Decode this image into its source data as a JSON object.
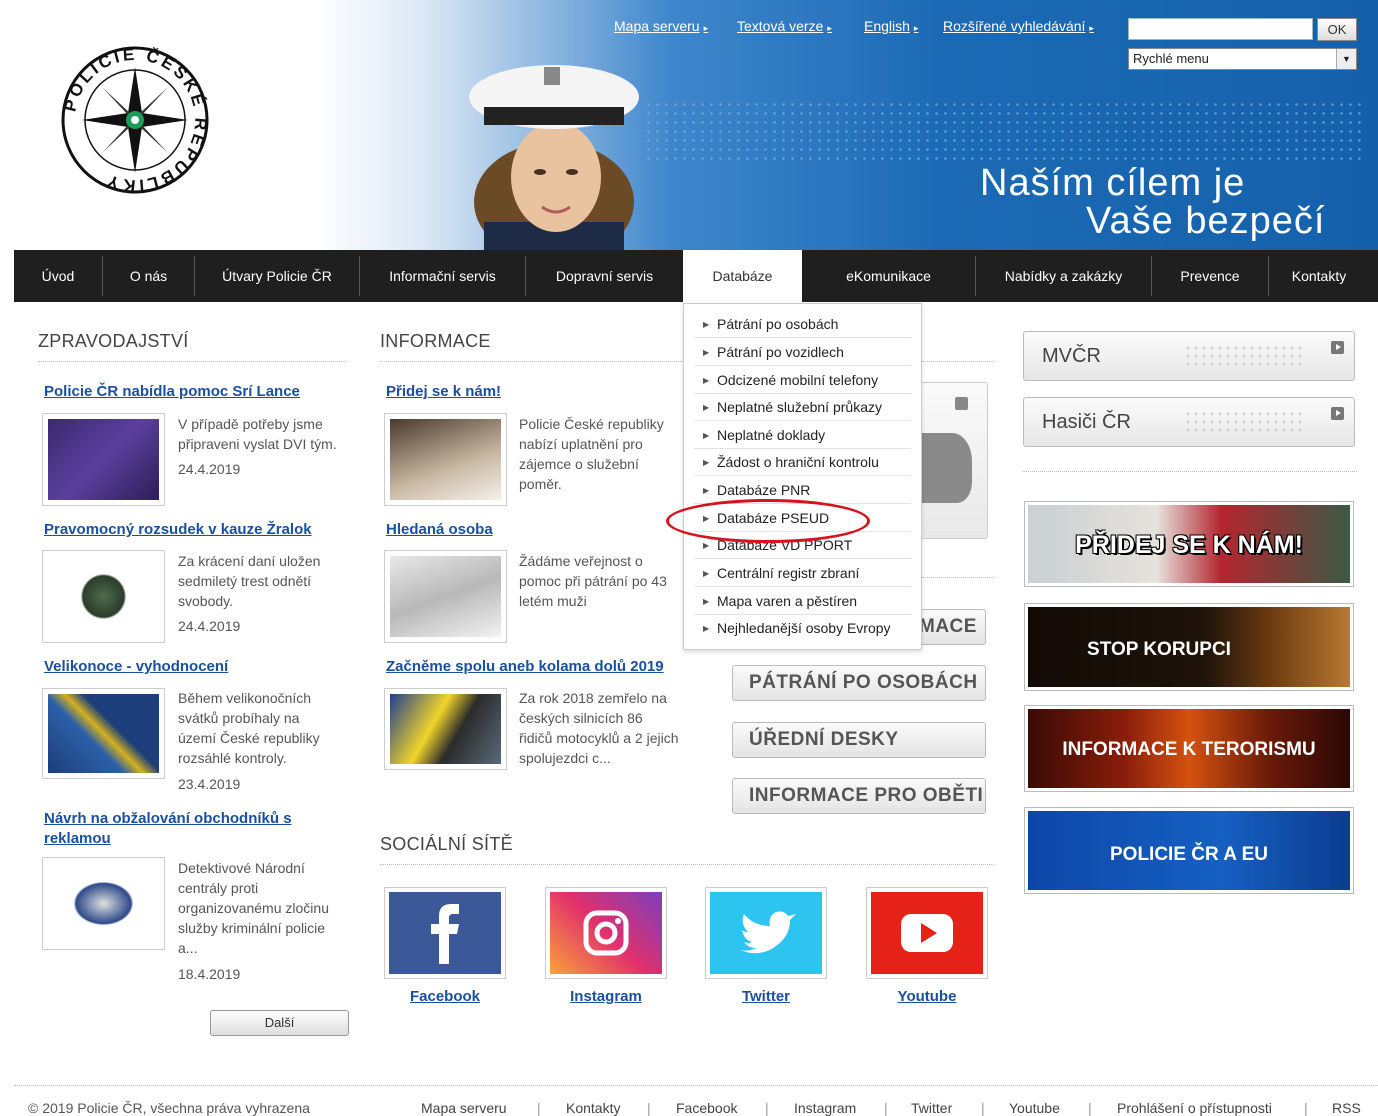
{
  "header": {
    "top_links": [
      "Mapa serveru",
      "Textová verze",
      "English",
      "Rozšířené vyhledávání"
    ],
    "search_placeholder": "",
    "search_button": "OK",
    "quick_menu": "Rychlé menu",
    "slogan_line1": "Naším cílem je",
    "slogan_line2": "Vaše bezpečí",
    "logo_text": "POLICIE ČESKÉ REPUBLIKY"
  },
  "nav": [
    "Úvod",
    "O nás",
    "Útvary Policie ČR",
    "Informační servis",
    "Dopravní servis",
    "Databáze",
    "eKomunikace",
    "Nabídky a zakázky",
    "Prevence",
    "Kontakty"
  ],
  "dropdown": [
    "Pátrání po osobách",
    "Pátrání po vozidlech",
    "Odcizené mobilní telefony",
    "Neplatné služební průkazy",
    "Neplatné doklady",
    "Žádost o hraniční kontrolu",
    "Databáze PNR",
    "Databáze PSEUD",
    "Databáze VD PPORT",
    "Centrální registr zbraní",
    "Mapa varen a pěstíren",
    "Nejhledanější osoby Evropy"
  ],
  "news": {
    "title": "ZPRAVODAJSTVÍ",
    "items": [
      {
        "title": "Policie ČR nabídla pomoc Srí Lance",
        "text": [
          "V případě potřeby jsme",
          "připraveni vyslat DVI tým."
        ],
        "date": "24.4.2019"
      },
      {
        "title": "Pravomocný rozsudek v kauze Žralok",
        "text": [
          "Za krácení daní uložen",
          "sedmiletý trest odnětí",
          "svobody."
        ],
        "date": "24.4.2019"
      },
      {
        "title": "Velikonoce - vyhodnocení",
        "text": [
          "Během velikonočních",
          "svátků probíhaly na",
          "území České republiky",
          "rozsáhlé kontroly."
        ],
        "date": "23.4.2019"
      },
      {
        "title_line1": "Návrh na obžalování obchodníků s",
        "title_line2": "reklamou",
        "text": [
          "Detektivové Národní",
          "centrály proti",
          "organizovanému zločinu",
          "služby kriminální policie",
          "a..."
        ],
        "date": "18.4.2019"
      }
    ],
    "more": "Další"
  },
  "info": {
    "title": "INFORMACE",
    "items": [
      {
        "title": "Přidej se k nám!",
        "text": [
          "Policie České republiky",
          "nabízí uplatnění pro",
          "zájemce o služební",
          "poměr."
        ]
      },
      {
        "title": "Hledaná osoba",
        "text": [
          "Žádáme veřejnost o",
          "pomoc při pátrání po 43",
          "letém muži"
        ]
      },
      {
        "title": "Začněme spolu aneb kolama dolů 2019",
        "text": [
          "Za rok 2018 zemřelo na",
          "českých silnicích 86",
          "řidičů motocyklů a 2 jejich",
          "spolujezdci c..."
        ]
      }
    ]
  },
  "mid_buttons": [
    "MACE",
    "PÁTRÁNÍ PO OSOBÁCH",
    "ÚŘEDNÍ DESKY",
    "INFORMACE PRO OBĚTI"
  ],
  "social": {
    "title": "SOCIÁLNÍ SÍTĚ",
    "links": [
      "Facebook",
      "Instagram",
      "Twitter",
      "Youtube"
    ]
  },
  "right": {
    "boxes": [
      "MVČR",
      "Hasiči ČR"
    ],
    "banners": [
      "PŘIDEJ SE K NÁM!",
      "STOP KORUPCI",
      "INFORMACE K TERORISMU",
      "POLICIE ČR A EU"
    ]
  },
  "footer": {
    "copyright": "© 2019 Policie ČR, všechna práva vyhrazena",
    "links": [
      "Mapa serveru",
      "Kontakty",
      "Facebook",
      "Instagram",
      "Twitter",
      "Youtube",
      "Prohlášení o přístupnosti",
      "RSS"
    ]
  },
  "colors": {
    "nav_bg": "#1f1f1f",
    "link": "#1b4fa0",
    "header_blue": "#1c6ab5",
    "highlight_circle": "#d8121d"
  }
}
